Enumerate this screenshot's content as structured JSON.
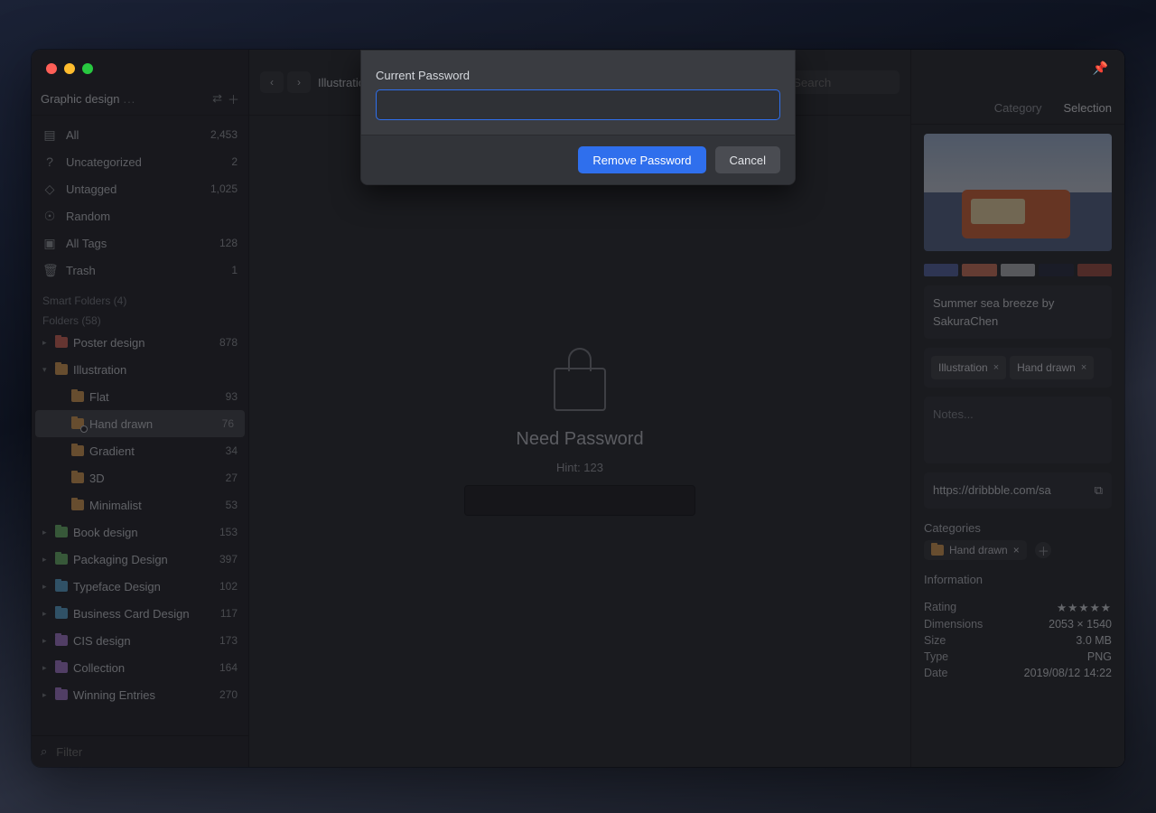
{
  "traffic": {
    "close": "",
    "min": "",
    "max": ""
  },
  "pin_icon": "📌",
  "library": {
    "title": "Graphic design",
    "more": "...",
    "switch_icon": "⇄",
    "add_icon": "＋"
  },
  "fixed": [
    {
      "icon": "▤",
      "label": "All",
      "count": "2,453"
    },
    {
      "icon": "?",
      "label": "Uncategorized",
      "count": "2"
    },
    {
      "icon": "◇",
      "label": "Untagged",
      "count": "1,025"
    },
    {
      "icon": "☉",
      "label": "Random",
      "count": ""
    },
    {
      "icon": "▣",
      "label": "All Tags",
      "count": "128"
    },
    {
      "icon": "🗑",
      "label": "Trash",
      "count": "1"
    }
  ],
  "sections": {
    "smart": "Smart Folders (4)",
    "folders": "Folders (58)"
  },
  "tree": [
    {
      "lvl": 1,
      "arrow": "▸",
      "color": "#d46a5e",
      "label": "Poster design",
      "count": "878"
    },
    {
      "lvl": 1,
      "arrow": "▾",
      "color": "#d9a15a",
      "label": "Illustration",
      "count": ""
    },
    {
      "lvl": 2,
      "arrow": "",
      "color": "#d9a15a",
      "label": "Flat",
      "count": "93"
    },
    {
      "lvl": 2,
      "arrow": "",
      "color": "#d9a15a",
      "label": "Hand drawn",
      "count": "76",
      "selected": true,
      "locked": true
    },
    {
      "lvl": 2,
      "arrow": "",
      "color": "#d9a15a",
      "label": "Gradient",
      "count": "34"
    },
    {
      "lvl": 2,
      "arrow": "",
      "color": "#d9a15a",
      "label": "3D",
      "count": "27"
    },
    {
      "lvl": 2,
      "arrow": "",
      "color": "#d9a15a",
      "label": "Minimalist",
      "count": "53"
    },
    {
      "lvl": 1,
      "arrow": "▸",
      "color": "#6fb86f",
      "label": "Book design",
      "count": "153"
    },
    {
      "lvl": 1,
      "arrow": "▸",
      "color": "#6fb86f",
      "label": "Packaging Design",
      "count": "397"
    },
    {
      "lvl": 1,
      "arrow": "▸",
      "color": "#5fa8d3",
      "label": "Typeface Design",
      "count": "102"
    },
    {
      "lvl": 1,
      "arrow": "▸",
      "color": "#5fa8d3",
      "label": "Business Card Design",
      "count": "117"
    },
    {
      "lvl": 1,
      "arrow": "▸",
      "color": "#a97fd1",
      "label": "CIS design",
      "count": "173"
    },
    {
      "lvl": 1,
      "arrow": "▸",
      "color": "#a97fd1",
      "label": "Collection",
      "count": "164"
    },
    {
      "lvl": 1,
      "arrow": "▸",
      "color": "#a97fd1",
      "label": "Winning Entries",
      "count": "270"
    }
  ],
  "filter": {
    "icon": "⌕",
    "placeholder": "Filter"
  },
  "toolbar": {
    "back": "‹",
    "fwd": "›",
    "crumb": "Illustration",
    "search_placeholder": "Search"
  },
  "locked": {
    "title": "Need Password",
    "hint": "Hint: 123"
  },
  "tabs": {
    "category": "Category",
    "selection": "Selection"
  },
  "detail": {
    "palette": [
      "#5b6aa8",
      "#d27a62",
      "#b7b9bd",
      "#2f3348",
      "#a5564a"
    ],
    "title": "Summer sea breeze by SakuraChen",
    "tags": [
      "Illustration",
      "Hand drawn"
    ],
    "notes_placeholder": "Notes...",
    "link": "https://dribbble.com/sa",
    "open_icon": "⧉",
    "categories_h": "Categories",
    "cat": {
      "label": "Hand drawn"
    },
    "info_h": "Information",
    "info": [
      {
        "k": "Rating",
        "v": "★★★★★",
        "stars": true
      },
      {
        "k": "Dimensions",
        "v": "2053 × 1540"
      },
      {
        "k": "Size",
        "v": "3.0 MB"
      },
      {
        "k": "Type",
        "v": "PNG"
      },
      {
        "k": "Date",
        "v": "2019/08/12 14:22"
      }
    ]
  },
  "modal": {
    "label": "Current Password",
    "remove": "Remove Password",
    "cancel": "Cancel"
  }
}
